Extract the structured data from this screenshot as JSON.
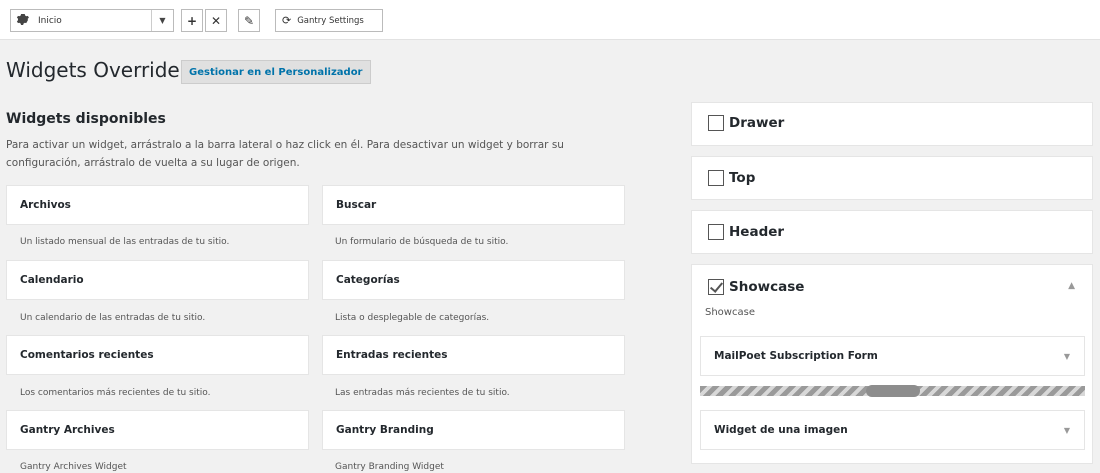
{
  "toolbar": {
    "select_value": "Inicio",
    "gantry_settings_label": "Gantry Settings"
  },
  "page": {
    "title": "Widgets Override",
    "manage_label": "Gestionar en el Personalizador"
  },
  "available": {
    "heading": "Widgets disponibles",
    "description": "Para activar un widget, arrástralo a la barra lateral o haz click en él. Para desactivar un widget y borrar su configuración, arrástralo de vuelta a su lugar de origen.",
    "widgets": [
      {
        "title": "Archivos",
        "desc": "Un listado mensual de las entradas de tu sitio."
      },
      {
        "title": "Buscar",
        "desc": "Un formulario de búsqueda de tu sitio."
      },
      {
        "title": "Calendario",
        "desc": "Un calendario de las entradas de tu sitio."
      },
      {
        "title": "Categorías",
        "desc": "Lista o desplegable de categorías."
      },
      {
        "title": "Comentarios recientes",
        "desc": "Los comentarios más recientes de tu sitio."
      },
      {
        "title": "Entradas recientes",
        "desc": "Las entradas más recientes de tu sitio."
      },
      {
        "title": "Gantry Archives",
        "desc": "Gantry Archives Widget"
      },
      {
        "title": "Gantry Branding",
        "desc": "Gantry Branding Widget"
      }
    ]
  },
  "sidebars": [
    {
      "label": "Drawer",
      "checked": false
    },
    {
      "label": "Top",
      "checked": false
    },
    {
      "label": "Header",
      "checked": false
    },
    {
      "label": "Showcase",
      "checked": true,
      "description": "Showcase",
      "widgets": [
        {
          "title": "MailPoet Subscription Form"
        },
        {
          "title": "Widget de una imagen"
        }
      ]
    }
  ],
  "icons": {
    "select": "gear-icon",
    "add": "plus-icon",
    "delete": "close-icon",
    "edit": "pencil-icon",
    "settings": "refresh-icon"
  }
}
